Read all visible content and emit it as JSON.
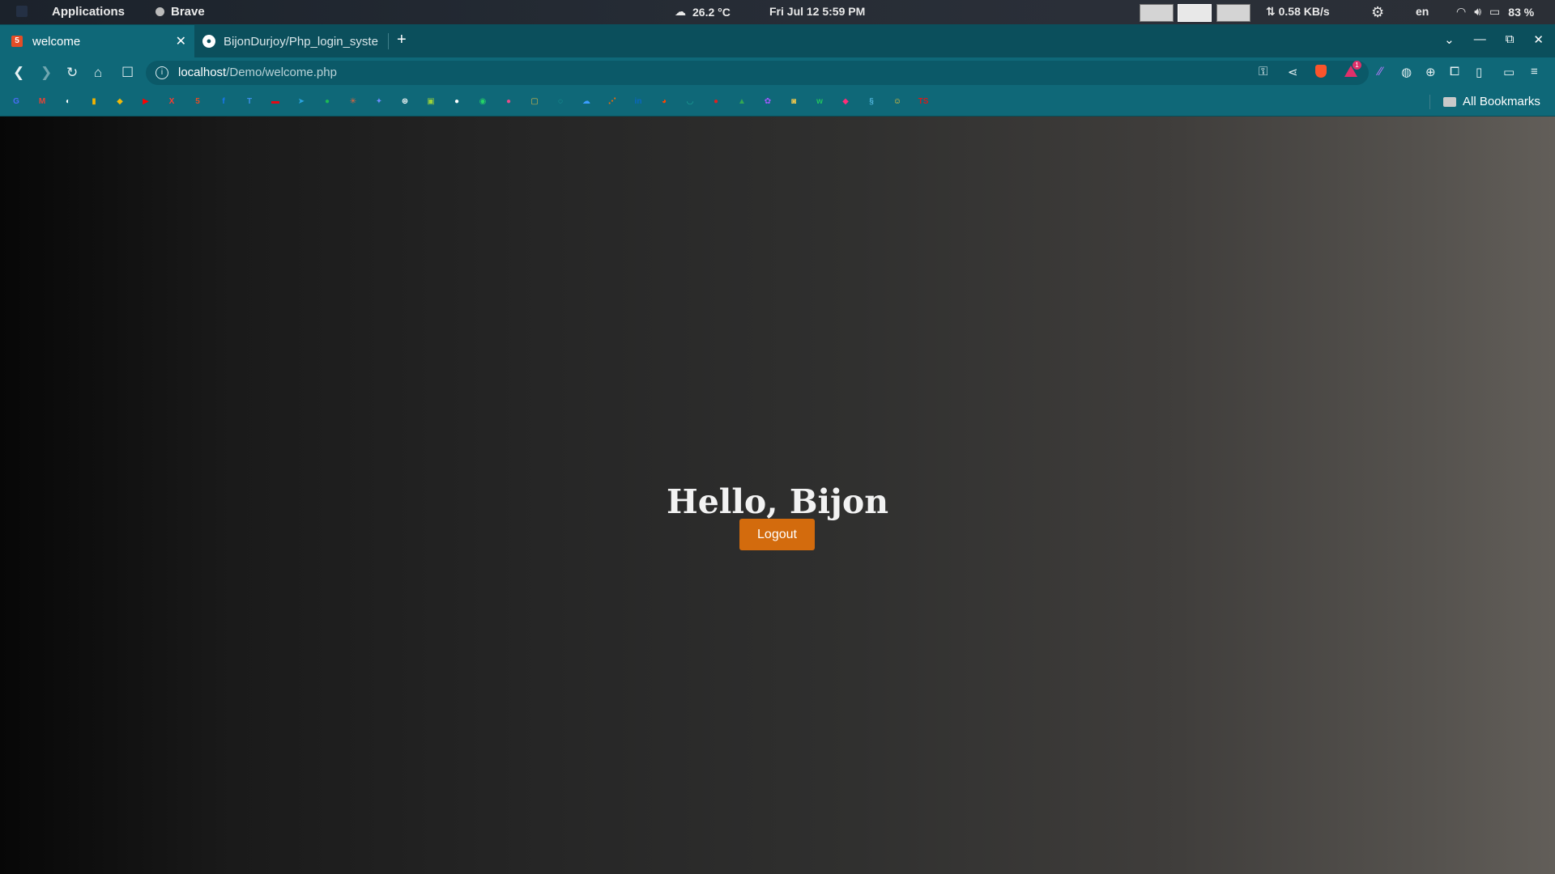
{
  "system_bar": {
    "menu_label": "Applications",
    "active_app": "Brave",
    "weather": "26.2 °C",
    "datetime": "Fri Jul 12   5:59 PM",
    "network_speed": "⇅ 0.58 KB/s",
    "language": "en",
    "battery": "83 %"
  },
  "tabs": [
    {
      "title": "welcome",
      "favicon": "html5-icon",
      "active": true
    },
    {
      "title": "BijonDurjoy/Php_login_syste",
      "favicon": "github-icon",
      "active": false
    }
  ],
  "address_bar": {
    "host": "localhost",
    "path": "/Demo/welcome.php"
  },
  "bookmarks": {
    "all_label": "All Bookmarks",
    "icons": [
      {
        "name": "translate-icon",
        "color": "#4a6cf7",
        "glyph": "G"
      },
      {
        "name": "gmail-icon",
        "color": "#ea4335",
        "glyph": "M"
      },
      {
        "name": "globe-icon",
        "color": "#ffffff",
        "glyph": "◐"
      },
      {
        "name": "analytics-icon",
        "color": "#f4b400",
        "glyph": "▮"
      },
      {
        "name": "binance-icon",
        "color": "#f0b90b",
        "glyph": "◆"
      },
      {
        "name": "youtube-icon",
        "color": "#ff0000",
        "glyph": "▶"
      },
      {
        "name": "x-icon",
        "color": "#ff3b30",
        "glyph": "X"
      },
      {
        "name": "html5-icon",
        "color": "#e44d26",
        "glyph": "5"
      },
      {
        "name": "facebook-icon",
        "color": "#1877f2",
        "glyph": "f"
      },
      {
        "name": "typora-icon",
        "color": "#3b8fe8",
        "glyph": "T"
      },
      {
        "name": "red-app-icon",
        "color": "#e50914",
        "glyph": "▬"
      },
      {
        "name": "telegram-icon",
        "color": "#2aa3e0",
        "glyph": "➤"
      },
      {
        "name": "green-app-icon",
        "color": "#1db954",
        "glyph": "●"
      },
      {
        "name": "spark-icon",
        "color": "#e8663d",
        "glyph": "✳"
      },
      {
        "name": "gemini-icon",
        "color": "#6b8cff",
        "glyph": "✦"
      },
      {
        "name": "chatgpt-icon",
        "color": "#ffffff",
        "glyph": "⊛"
      },
      {
        "name": "image-icon",
        "color": "#9bd23c",
        "glyph": "▣"
      },
      {
        "name": "github-icon",
        "color": "#ffffff",
        "glyph": "●"
      },
      {
        "name": "whatsapp-icon",
        "color": "#25d366",
        "glyph": "◉"
      },
      {
        "name": "dribbble-icon",
        "color": "#ea4c89",
        "glyph": "●"
      },
      {
        "name": "terminal-icon",
        "color": "#d4b84a",
        "glyph": "▢"
      },
      {
        "name": "edge-icon",
        "color": "#1fb5a5",
        "glyph": "◌"
      },
      {
        "name": "cloud-icon",
        "color": "#3b9dff",
        "glyph": "☁"
      },
      {
        "name": "share-icon",
        "color": "#ff6a00",
        "glyph": "⋰"
      },
      {
        "name": "linkedin-icon",
        "color": "#0a66c2",
        "glyph": "in"
      },
      {
        "name": "reddit-icon",
        "color": "#ff4500",
        "glyph": "◕"
      },
      {
        "name": "smile-app-icon",
        "color": "#1fa89a",
        "glyph": "◡"
      },
      {
        "name": "record-icon",
        "color": "#e02020",
        "glyph": "●"
      },
      {
        "name": "drive-icon",
        "color": "#34a853",
        "glyph": "▲"
      },
      {
        "name": "figma-icon",
        "color": "#a259ff",
        "glyph": "✿"
      },
      {
        "name": "pacman-icon",
        "color": "#f2c94c",
        "glyph": "◙"
      },
      {
        "name": "webflow-icon",
        "color": "#22c55e",
        "glyph": "w"
      },
      {
        "name": "pink-app-icon",
        "color": "#ff2d78",
        "glyph": "◆"
      },
      {
        "name": "flow-icon",
        "color": "#4fb3d9",
        "glyph": "§"
      },
      {
        "name": "emoji-icon",
        "color": "#ffcc33",
        "glyph": "☺"
      },
      {
        "name": "ts-icon",
        "color": "#d71a1a",
        "glyph": "TS"
      }
    ]
  },
  "page": {
    "greeting": "Hello, Bijon",
    "logout_label": "Logout",
    "button_color": "#d36b0d"
  }
}
